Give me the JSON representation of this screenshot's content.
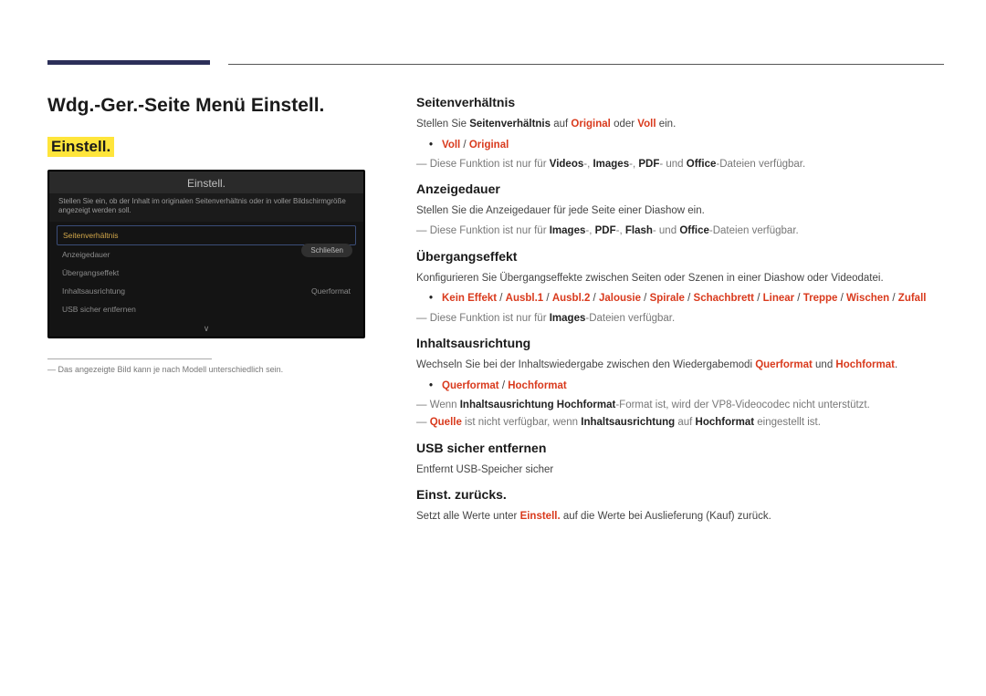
{
  "left": {
    "title": "Wdg.-Ger.-Seite Menü Einstell.",
    "subhead": "Einstell.",
    "shot": {
      "title": "Einstell.",
      "desc": "Stellen Sie ein, ob der Inhalt im originalen Seitenverhältnis oder in voller Bildschirmgröße angezeigt werden soll.",
      "items": {
        "i0": "Seitenverhältnis",
        "i1": "Anzeigedauer",
        "i2": "Übergangseffekt",
        "i3": "Inhaltsausrichtung",
        "i3v": "Querformat",
        "i4": "USB sicher entfernen"
      },
      "close": "Schließen",
      "arrow": "∨"
    },
    "footnote": "Das angezeigte Bild kann je nach Modell unterschiedlich sein."
  },
  "s1": {
    "h": "Seitenverhältnis",
    "p1a": "Stellen Sie ",
    "p1b": "Seitenverhältnis",
    "p1c": " auf ",
    "p1d": "Original",
    "p1e": " oder ",
    "p1f": "Voll",
    "p1g": " ein.",
    "b1a": "Voll",
    "b1s": " / ",
    "b1b": "Original",
    "n1a": "Diese Funktion ist nur für ",
    "n1b": "Videos",
    "n1c": "-, ",
    "n1d": "Images",
    "n1e": "-, ",
    "n1f": "PDF",
    "n1g": "- und ",
    "n1h": "Office",
    "n1i": "-Dateien verfügbar."
  },
  "s2": {
    "h": "Anzeigedauer",
    "p1": "Stellen Sie die Anzeigedauer für jede Seite einer Diashow ein.",
    "n1a": "Diese Funktion ist nur für ",
    "n1b": "Images",
    "n1c": "-, ",
    "n1d": "PDF",
    "n1e": "-, ",
    "n1f": "Flash",
    "n1g": "- und ",
    "n1h": "Office",
    "n1i": "-Dateien verfügbar."
  },
  "s3": {
    "h": "Übergangseffekt",
    "p1": "Konfigurieren Sie Übergangseffekte zwischen Seiten oder Szenen in einer Diashow oder Videodatei.",
    "opts": {
      "o0": "Kein Effekt",
      "o1": "Ausbl.1",
      "o2": "Ausbl.2",
      "o3": "Jalousie",
      "o4": "Spirale",
      "o5": "Schachbrett",
      "o6": "Linear",
      "o7": "Treppe",
      "o8": "Wischen",
      "o9": "Zufall"
    },
    "sep": " / ",
    "n1a": "Diese Funktion ist nur für ",
    "n1b": "Images",
    "n1c": "-Dateien verfügbar."
  },
  "s4": {
    "h": "Inhaltsausrichtung",
    "p1a": "Wechseln Sie bei der Inhaltswiedergabe zwischen den Wiedergabemodi ",
    "p1b": "Querformat",
    "p1c": " und ",
    "p1d": "Hochformat",
    "p1e": ".",
    "b1a": "Querformat",
    "b1s": " / ",
    "b1b": "Hochformat",
    "n1a": "Wenn ",
    "n1b": "Inhaltsausrichtung Hochformat",
    "n1c": "-Format ist, wird der VP8-Videocodec nicht unterstützt.",
    "n2a": "Quelle",
    "n2b": " ist nicht verfügbar, wenn ",
    "n2c": "Inhaltsausrichtung",
    "n2d": " auf ",
    "n2e": "Hochformat",
    "n2f": " eingestellt ist."
  },
  "s5": {
    "h": "USB sicher entfernen",
    "p1": "Entfernt USB-Speicher sicher"
  },
  "s6": {
    "h": "Einst. zurücks.",
    "p1a": "Setzt alle Werte unter  ",
    "p1b": "Einstell.",
    "p1c": " auf die Werte bei Auslieferung (Kauf) zurück."
  }
}
